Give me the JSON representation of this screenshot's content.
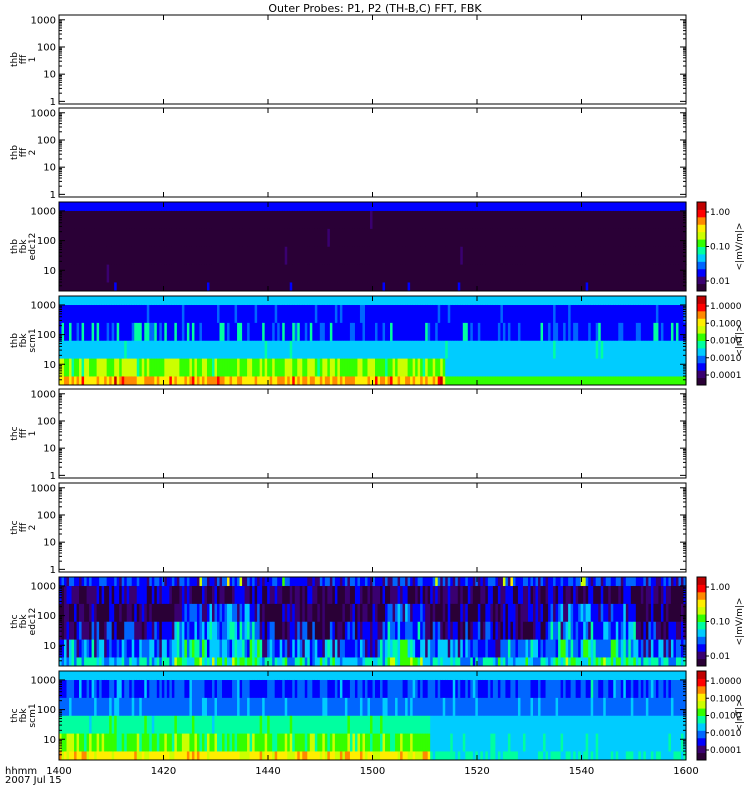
{
  "chart_data": {
    "type": "heatmap",
    "title": "Outer Probes: P1, P2 (TH-B,C) FFT, FBK",
    "x_axis": {
      "label_line1": "hhmm",
      "label_line2": "2007 Jul 15",
      "ticks": [
        "1400",
        "1420",
        "1440",
        "1500",
        "1520",
        "1540",
        "1600"
      ],
      "range": [
        "14:00",
        "16:00"
      ]
    },
    "panels": [
      {
        "id": "thb-fff1",
        "label": [
          "thb",
          "fff",
          "1"
        ],
        "kind": "empty",
        "scale": "log",
        "y_ticks": [
          "1000",
          "100",
          "10",
          "1"
        ],
        "colorbar": null
      },
      {
        "id": "thb-fff2",
        "label": [
          "thb",
          "fff",
          "2"
        ],
        "kind": "empty",
        "scale": "log",
        "y_ticks": [
          "1000",
          "100",
          "10",
          "1"
        ],
        "colorbar": null
      },
      {
        "id": "thb-fbk-edc12",
        "label": [
          "thb",
          "fbk",
          "edc12"
        ],
        "kind": "spectrogram",
        "scale": "log",
        "y_ticks": [
          "1000",
          "100",
          "10"
        ],
        "colorbar": {
          "unit": "<|mV/m|>",
          "ticks": [
            "1.00",
            "0.10",
            "0.01"
          ]
        },
        "bands": [
          {
            "frequency_hz": 2,
            "level": "low"
          },
          {
            "frequency_hz": 8,
            "level": "very_low"
          },
          {
            "frequency_hz": 32,
            "level": "very_low"
          },
          {
            "frequency_hz": 128,
            "level": "very_low"
          },
          {
            "frequency_hz": 512,
            "level": "very_low"
          },
          {
            "frequency_hz": 2048,
            "level": "moderate_blue"
          }
        ]
      },
      {
        "id": "thb-fbk-scm1",
        "label": [
          "thb",
          "fbk",
          "scm1"
        ],
        "kind": "spectrogram",
        "scale": "log",
        "y_ticks": [
          "1000",
          "100",
          "10"
        ],
        "colorbar": {
          "unit": "<|nT|>",
          "ticks": [
            "1.0000",
            "0.1000",
            "0.0100",
            "0.0010",
            "0.0001"
          ]
        },
        "bands": [
          {
            "frequency_hz": 2,
            "level": "high_until_1513_then_green"
          },
          {
            "frequency_hz": 8,
            "level": "green_yellow_until_1513_then_cyan"
          },
          {
            "frequency_hz": 32,
            "level": "cyan"
          },
          {
            "frequency_hz": 128,
            "level": "blue_with_cyan_spikes"
          },
          {
            "frequency_hz": 512,
            "level": "blue"
          },
          {
            "frequency_hz": 2048,
            "level": "cyan"
          }
        ]
      },
      {
        "id": "thc-fff1",
        "label": [
          "thc",
          "fff",
          "1"
        ],
        "kind": "empty",
        "scale": "log",
        "y_ticks": [
          "1000",
          "100",
          "10",
          "1"
        ],
        "colorbar": null
      },
      {
        "id": "thc-fff2",
        "label": [
          "thc",
          "fff",
          "2"
        ],
        "kind": "empty",
        "scale": "log",
        "y_ticks": [
          "1000",
          "100",
          "10",
          "1"
        ],
        "colorbar": null
      },
      {
        "id": "thc-fbk-edc12",
        "label": [
          "thc",
          "fbk",
          "edc12"
        ],
        "kind": "spectrogram",
        "scale": "log",
        "y_ticks": [
          "1000",
          "100",
          "10"
        ],
        "colorbar": {
          "unit": "<|mV/m|>",
          "ticks": [
            "1.00",
            "0.10",
            "0.01"
          ]
        },
        "bands": [
          {
            "frequency_hz": 2,
            "level": "variable_cyan_yellow"
          },
          {
            "frequency_hz": 8,
            "level": "variable_blue_cyan"
          },
          {
            "frequency_hz": 32,
            "level": "variable_dark_blue"
          },
          {
            "frequency_hz": 128,
            "level": "variable_dark_blue"
          },
          {
            "frequency_hz": 512,
            "level": "dark_blue"
          },
          {
            "frequency_hz": 2048,
            "level": "blue_with_spikes"
          }
        ]
      },
      {
        "id": "thc-fbk-scm1",
        "label": [
          "thc",
          "fbk",
          "scm1"
        ],
        "kind": "spectrogram",
        "scale": "log",
        "y_ticks": [
          "1000",
          "100",
          "10"
        ],
        "colorbar": {
          "unit": "<|nT|>",
          "ticks": [
            "1.0000",
            "0.1000",
            "0.0100",
            "0.0010",
            "0.0001"
          ]
        },
        "bands": [
          {
            "frequency_hz": 2,
            "level": "yellow_until_1510_then_cyan"
          },
          {
            "frequency_hz": 8,
            "level": "green_until_1510_then_cyan"
          },
          {
            "frequency_hz": 32,
            "level": "cyan"
          },
          {
            "frequency_hz": 128,
            "level": "blue_cyan"
          },
          {
            "frequency_hz": 512,
            "level": "blue"
          },
          {
            "frequency_hz": 2048,
            "level": "cyan"
          }
        ]
      }
    ],
    "colormap": [
      "#2a0036",
      "#3a0070",
      "#0000ff",
      "#0066ff",
      "#00ccff",
      "#00ffa0",
      "#33ff00",
      "#ccff00",
      "#ffee00",
      "#ff8800",
      "#ff0000",
      "#c00000"
    ]
  }
}
